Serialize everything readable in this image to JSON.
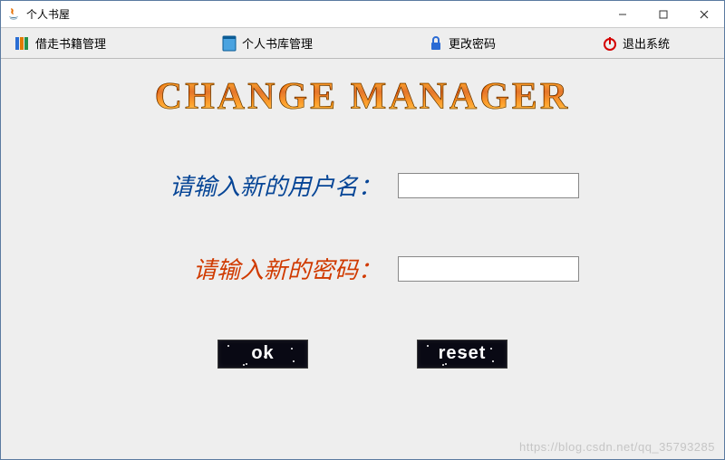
{
  "window": {
    "title": "个人书屋"
  },
  "menubar": {
    "items": [
      {
        "label": "借走书籍管理",
        "icon": "books"
      },
      {
        "label": "个人书库管理",
        "icon": "book"
      },
      {
        "label": "更改密码",
        "icon": "lock"
      },
      {
        "label": "退出系统",
        "icon": "power"
      }
    ]
  },
  "heading": "CHANGE MANAGER",
  "form": {
    "username_label": "请输入新的用户名：",
    "username_value": "",
    "password_label": "请输入新的密码：",
    "password_value": ""
  },
  "buttons": {
    "ok": "ok",
    "reset": "reset"
  },
  "watermark": "https://blog.csdn.net/qq_35793285"
}
